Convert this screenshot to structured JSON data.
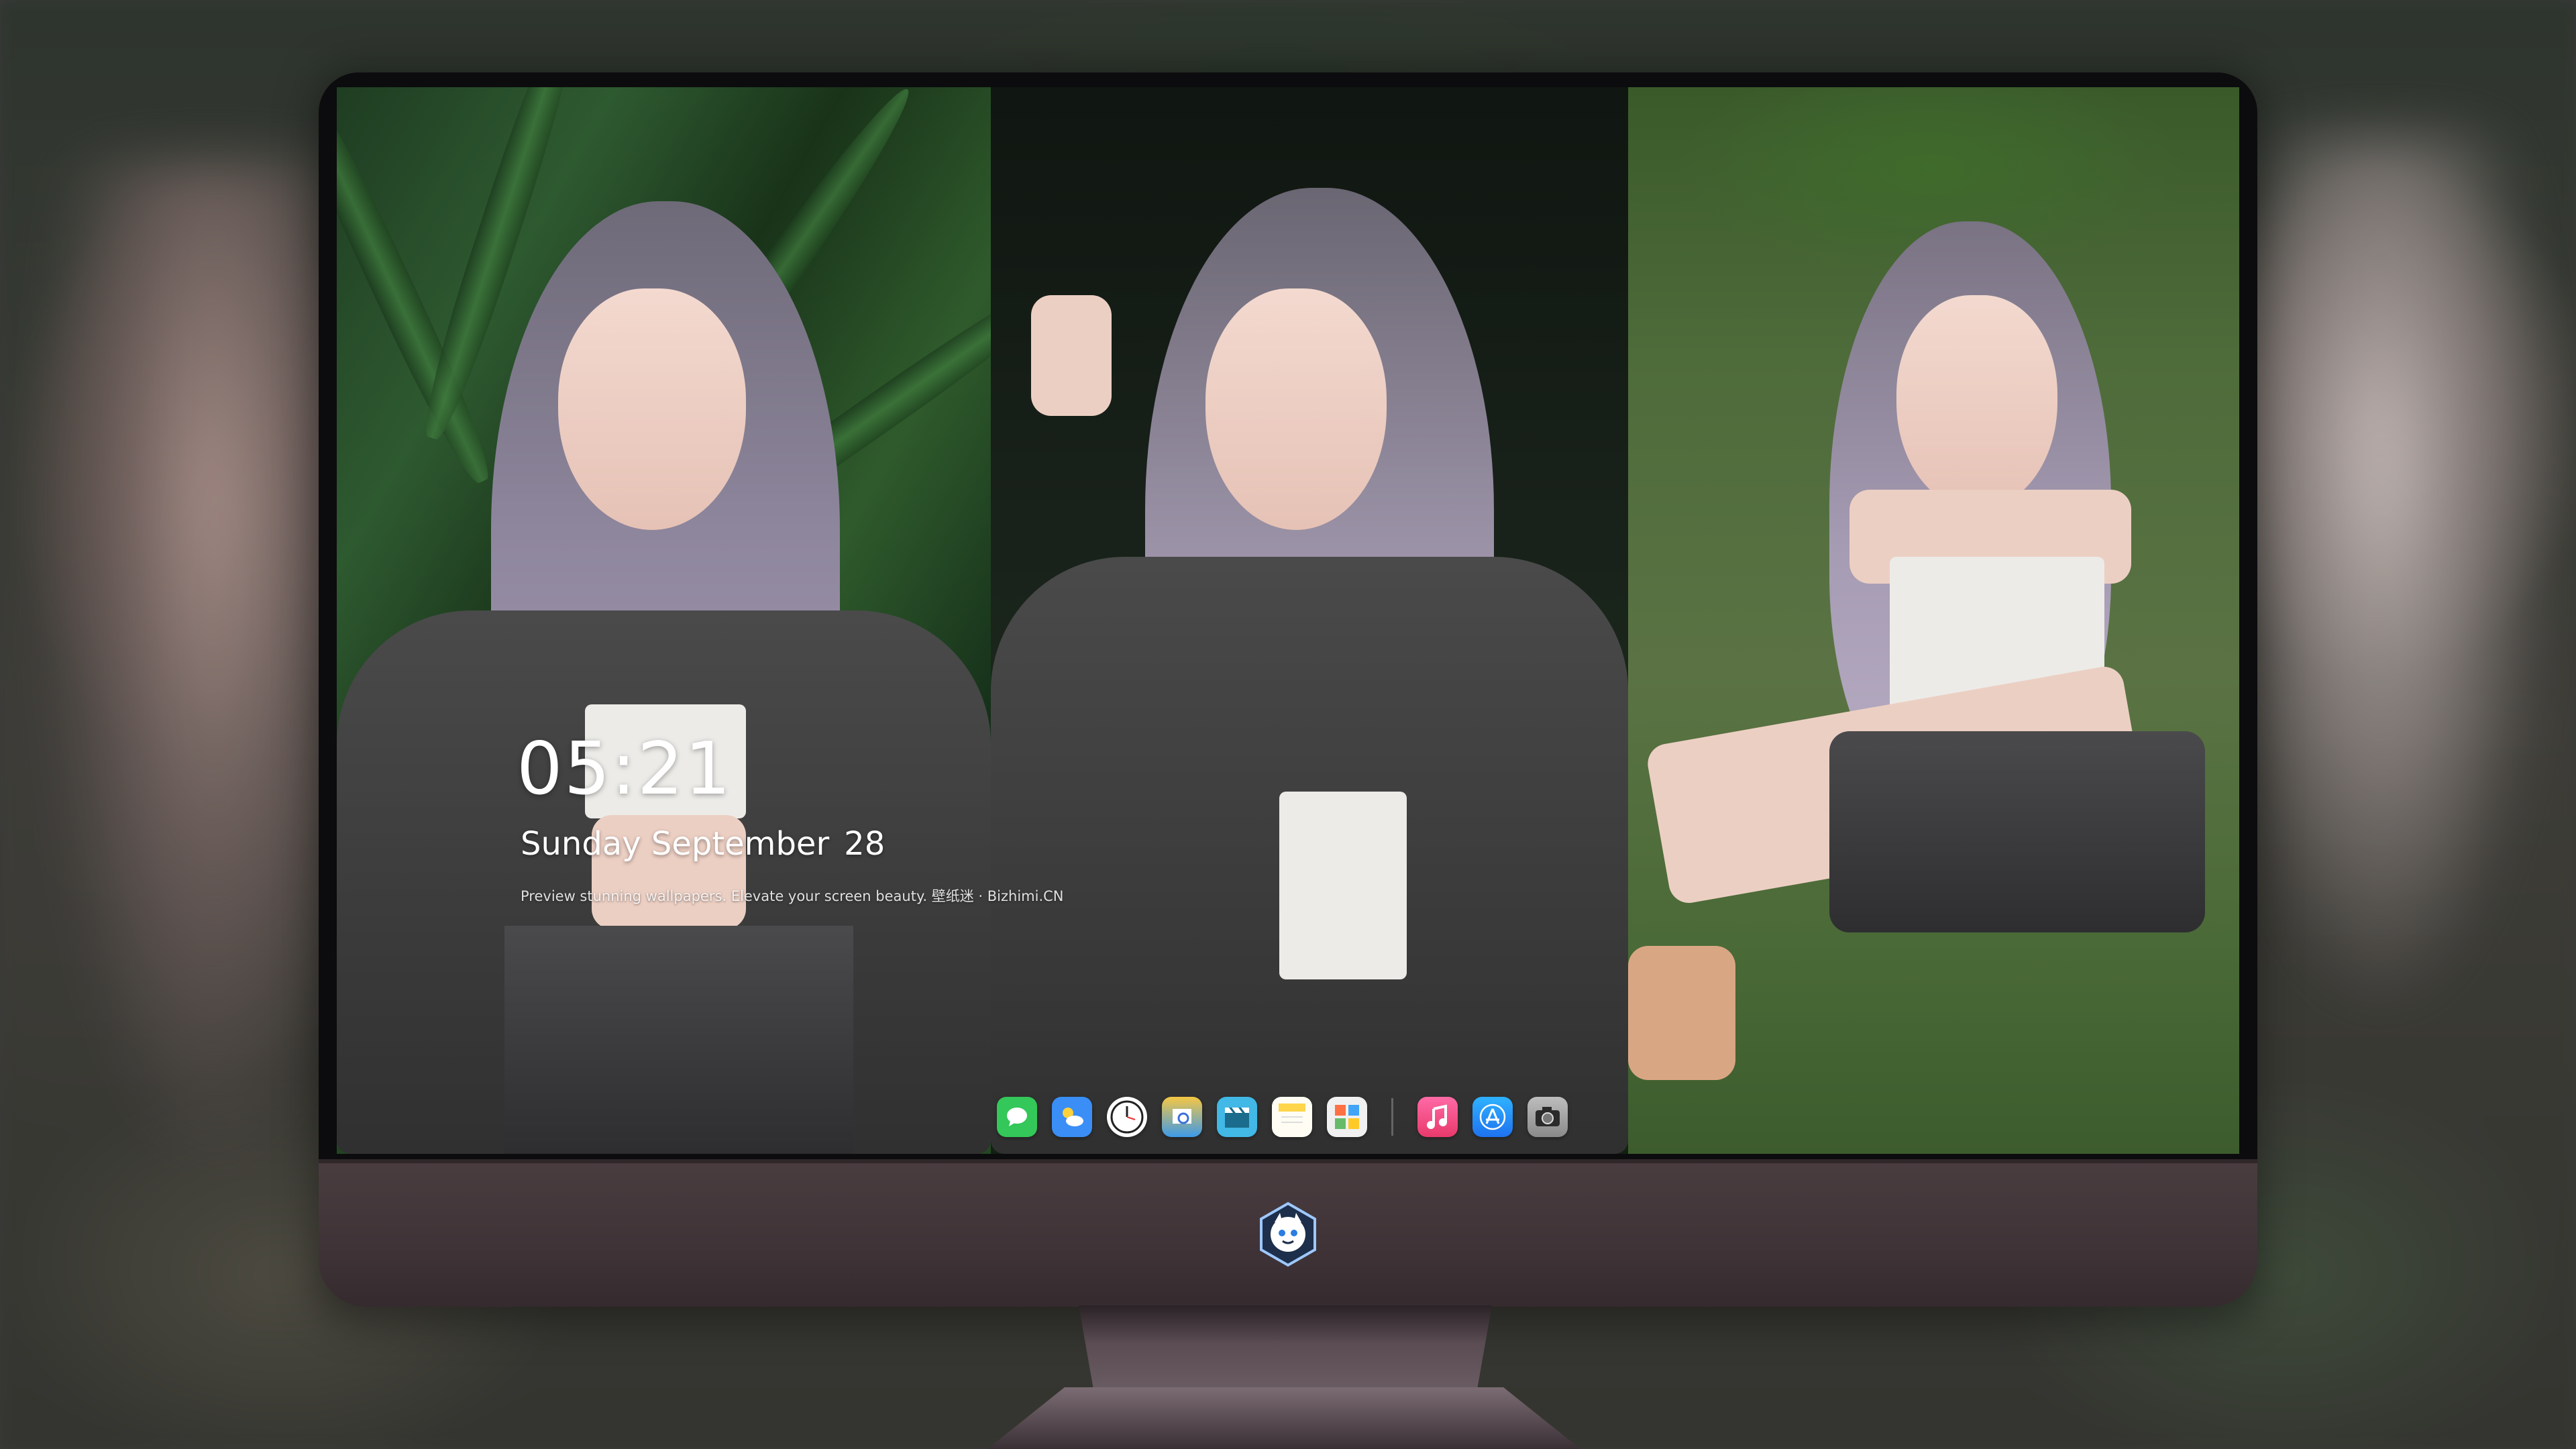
{
  "lock_screen": {
    "time": "05:21",
    "date": "Sunday September",
    "day": "28",
    "caption": "Preview stunning wallpapers. Elevate your screen beauty. 壁纸迷 · Bizhimi.CN"
  },
  "dock": {
    "apps": [
      {
        "name": "messages-icon",
        "color": "#34c759"
      },
      {
        "name": "weather-icon",
        "color": "#3a8ef6"
      },
      {
        "name": "clock-icon",
        "color": "#f2f2f2"
      },
      {
        "name": "preview-icon",
        "color": "#f6c744"
      },
      {
        "name": "clips-icon",
        "color": "#41b8e6"
      },
      {
        "name": "notes-icon",
        "color": "#ffd54a"
      },
      {
        "name": "photo-grid-icon",
        "color": "#e8e8e8"
      },
      {
        "name": "music-icon",
        "color": "#ff4f8b"
      },
      {
        "name": "app-store-icon",
        "color": "#1e8cf5"
      },
      {
        "name": "camera-icon",
        "color": "#9a9a9a"
      }
    ]
  },
  "colors": {
    "bezel": "#0c0c0e",
    "chin": "#4a3d40",
    "stand": "#5e5157"
  }
}
